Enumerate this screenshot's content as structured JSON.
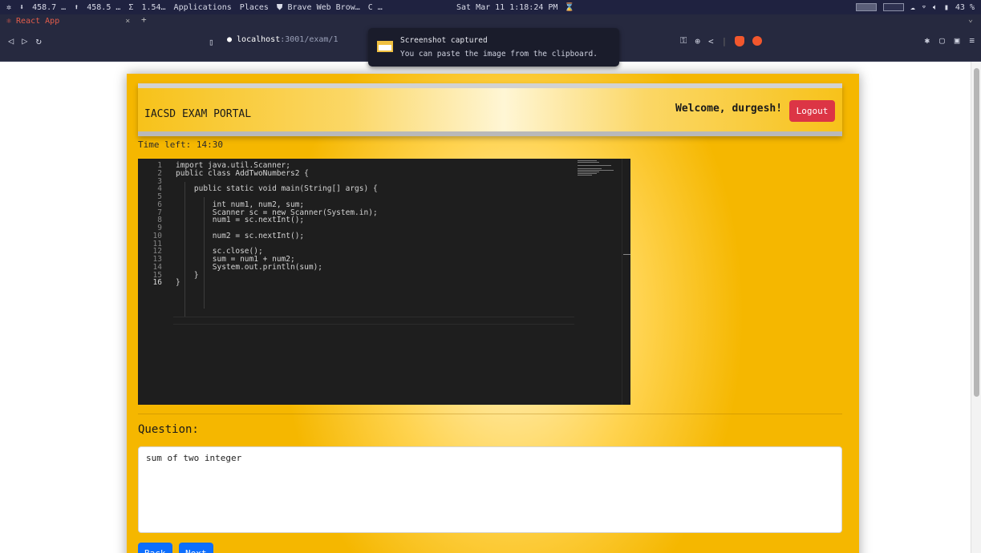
{
  "system_bar": {
    "down_rate": "458.7 …",
    "up_rate": "458.5 …",
    "sigma": "Σ",
    "sigma_value": "1.54…",
    "menu_applications": "Applications",
    "menu_places": "Places",
    "active_window": "Brave Web Brow…",
    "loading": "C …",
    "clock": "Sat Mar 11  1:18:24 PM",
    "battery": "43 %"
  },
  "browser": {
    "tab_title": "React App",
    "tab_close": "×",
    "new_tab": "+",
    "tab_menu": "⌄",
    "url_host": "localhost",
    "url_path": ":3001/exam/1"
  },
  "toast": {
    "title": "Screenshot captured",
    "message": "You can paste the image from the clipboard."
  },
  "app": {
    "brand": "IACSD EXAM PORTAL",
    "welcome": "Welcome, durgesh!",
    "logout_label": "Logout",
    "timer": "Time left: 14:30",
    "question_label": "Question:",
    "question_text": "sum of two integer",
    "back_label": "Back",
    "next_label": "Next"
  },
  "editor": {
    "lines": [
      "import java.util.Scanner;",
      "public class AddTwoNumbers2 {",
      "",
      "    public static void main(String[] args) {",
      "",
      "        int num1, num2, sum;",
      "        Scanner sc = new Scanner(System.in);",
      "        num1 = sc.nextInt();",
      "",
      "        num2 = sc.nextInt();",
      "",
      "        sc.close();",
      "        sum = num1 + num2;",
      "        System.out.println(sum);",
      "    }",
      "}"
    ],
    "current_line": 16
  }
}
